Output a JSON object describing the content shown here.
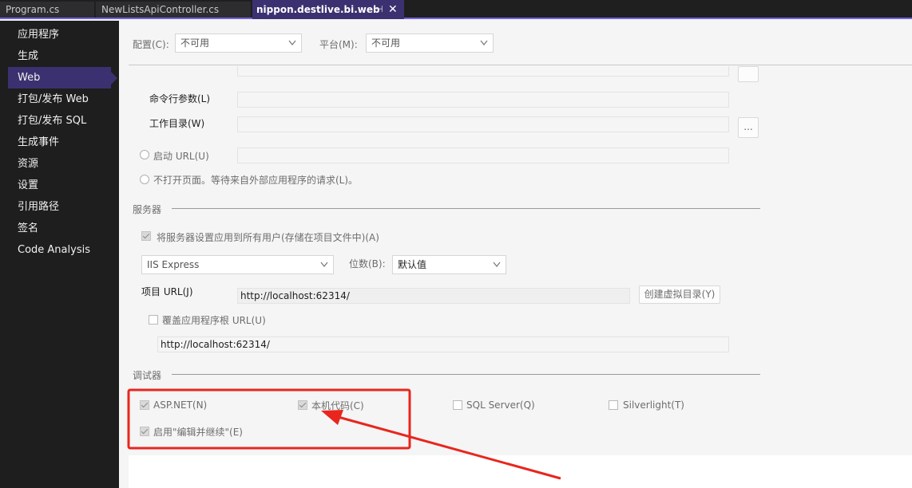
{
  "tabs": [
    {
      "label": "Program.cs"
    },
    {
      "label": "NewListsApiController.cs"
    },
    {
      "label": "nippon.destlive.bi.web",
      "pin": "⊣",
      "close": "✕"
    }
  ],
  "sidebar": {
    "items": [
      {
        "label": "应用程序"
      },
      {
        "label": "生成"
      },
      {
        "label": "Web"
      },
      {
        "label": "打包/发布 Web"
      },
      {
        "label": "打包/发布 SQL"
      },
      {
        "label": "生成事件"
      },
      {
        "label": "资源"
      },
      {
        "label": "设置"
      },
      {
        "label": "引用路径"
      },
      {
        "label": "签名"
      },
      {
        "label": "Code Analysis"
      }
    ],
    "selected": "Web"
  },
  "config_bar": {
    "config_label": "配置(C):",
    "config_value": "不可用",
    "platform_label": "平台(M):",
    "platform_value": "不可用"
  },
  "start_action": {
    "cmd_args_label": "命令行参数(L)",
    "cmd_args_value": "",
    "workdir_label": "工作目录(W)",
    "workdir_value": "",
    "browse_label": "...",
    "start_url_label": "启动 URL(U)",
    "start_url_value": "",
    "no_open_label": "不打开页面。等待来自外部应用程序的请求(L)。"
  },
  "servers": {
    "section_title": "服务器",
    "apply_all_label": "将服务器设置应用到所有用户(存储在项目文件中)(A)",
    "apply_all_checked": true,
    "server_value": "IIS Express",
    "bitness_label": "位数(B):",
    "bitness_value": "默认值",
    "project_url_label": "项目 URL(J)",
    "project_url_value": "http://localhost:62314/",
    "create_vdir_label": "创建虚拟目录(Y)",
    "override_root_label": "覆盖应用程序根 URL(U)",
    "override_root_checked": false,
    "override_root_value": "http://localhost:62314/"
  },
  "debuggers": {
    "section_title": "调试器",
    "items": [
      {
        "label": "ASP.NET(N)",
        "checked": true
      },
      {
        "label": "本机代码(C)",
        "checked": true
      },
      {
        "label": "SQL Server(Q)",
        "checked": false
      },
      {
        "label": "Silverlight(T)",
        "checked": false
      },
      {
        "label": "启用\"编辑并继续\"(E)",
        "checked": true
      }
    ]
  },
  "colors": {
    "accent": "#3c3170",
    "annotation": "#e8261e"
  }
}
